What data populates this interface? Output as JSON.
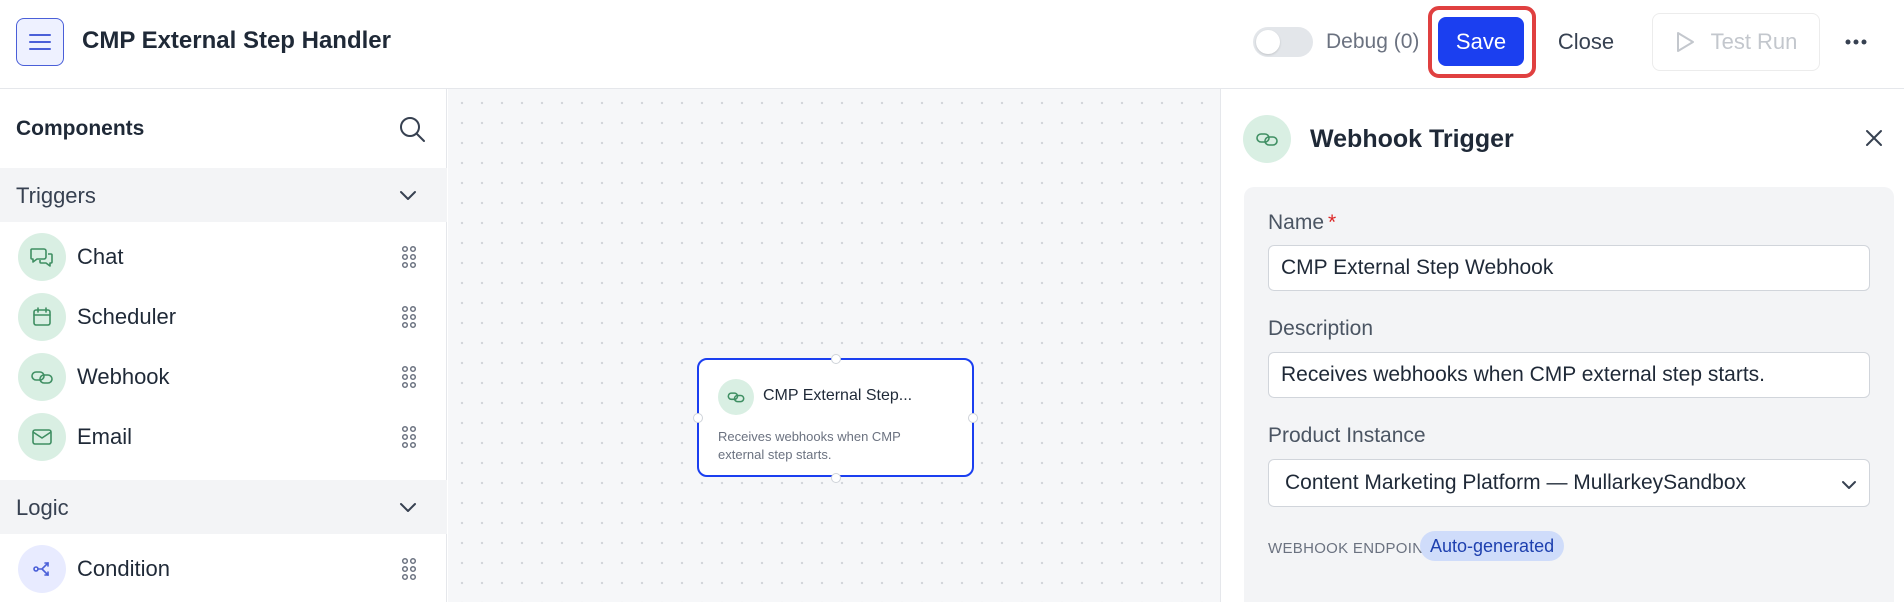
{
  "header": {
    "title": "CMP External Step Handler",
    "debug_label": "Debug (0)",
    "save_label": "Save",
    "close_label": "Close",
    "test_run_label": "Test Run"
  },
  "sidebar": {
    "title": "Components",
    "sections": [
      {
        "label": "Triggers",
        "items": [
          {
            "label": "Chat",
            "icon": "chat-icon"
          },
          {
            "label": "Scheduler",
            "icon": "calendar-icon"
          },
          {
            "label": "Webhook",
            "icon": "link-icon"
          },
          {
            "label": "Email",
            "icon": "mail-icon"
          }
        ]
      },
      {
        "label": "Logic",
        "items": [
          {
            "label": "Condition",
            "icon": "branch-icon"
          }
        ]
      }
    ]
  },
  "canvas": {
    "node": {
      "title": "CMP External Step...",
      "description": "Receives webhooks when CMP external step starts."
    }
  },
  "panel": {
    "title": "Webhook Trigger",
    "name_label": "Name",
    "name_required_mark": "*",
    "name_value": "CMP External Step Webhook",
    "description_label": "Description",
    "description_value": "Receives webhooks when CMP external step starts.",
    "product_instance_label": "Product Instance",
    "product_instance_value": "Content Marketing Platform — MullarkeySandbox",
    "webhook_endpoint_label": "WEBHOOK ENDPOINT",
    "webhook_endpoint_badge": "Auto-generated"
  },
  "colors": {
    "primary": "#1b3ff0",
    "highlight_outline": "#e04040",
    "icon_bg_green": "#d9efe3",
    "icon_fg_green": "#3f8f63"
  }
}
